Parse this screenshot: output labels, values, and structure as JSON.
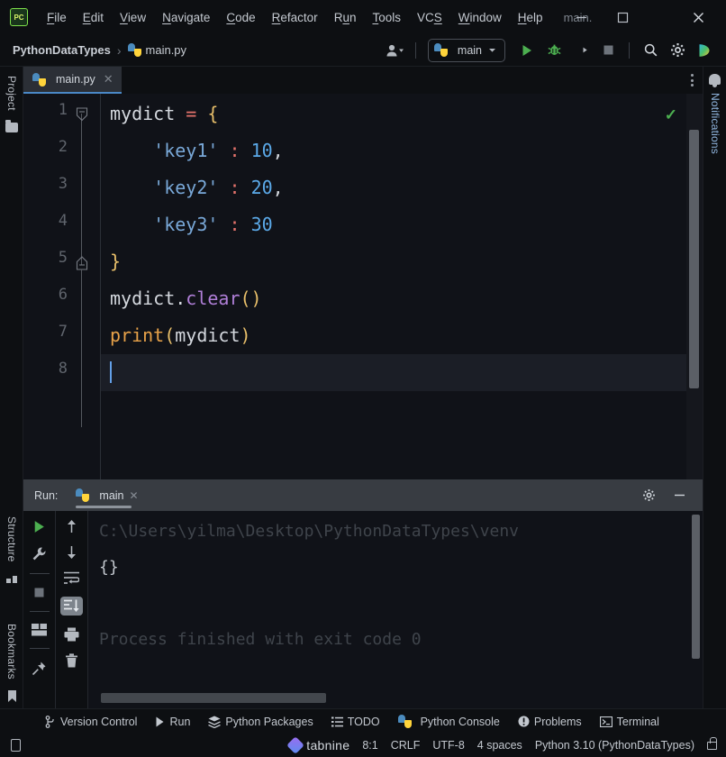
{
  "window": {
    "title": "main.",
    "app_icon": "pycharm-logo-icon",
    "minimize_label": "─",
    "maximize_label": "□",
    "close_label": "✕"
  },
  "menubar": {
    "items": [
      {
        "label": "File",
        "mnemonic": "F"
      },
      {
        "label": "Edit",
        "mnemonic": "E"
      },
      {
        "label": "View",
        "mnemonic": "V"
      },
      {
        "label": "Navigate",
        "mnemonic": "N"
      },
      {
        "label": "Code",
        "mnemonic": "C"
      },
      {
        "label": "Refactor",
        "mnemonic": "R"
      },
      {
        "label": "Run",
        "mnemonic": "u"
      },
      {
        "label": "Tools",
        "mnemonic": "T"
      },
      {
        "label": "VCS",
        "mnemonic": "S"
      },
      {
        "label": "Window",
        "mnemonic": "W"
      },
      {
        "label": "Help",
        "mnemonic": "H"
      }
    ]
  },
  "toolbar": {
    "breadcrumb": {
      "project": "PythonDataTypes",
      "separator": "›",
      "file": "main.py",
      "file_icon": "python-file-icon"
    },
    "account_icon": "user-account-icon",
    "run_config": {
      "name": "main",
      "icon": "python-config-icon",
      "dropdown_icon": "chevron-down-icon"
    },
    "actions": [
      {
        "name": "run-button",
        "icon": "run-triangle-icon"
      },
      {
        "name": "debug-button",
        "icon": "debug-bug-icon"
      },
      {
        "name": "run-with-coverage-button",
        "icon": "coverage-icon"
      },
      {
        "name": "stop-button",
        "icon": "stop-square-icon"
      },
      {
        "name": "search-everywhere-button",
        "icon": "search-icon"
      },
      {
        "name": "settings-button",
        "icon": "gear-icon"
      },
      {
        "name": "ai-assistant-button",
        "icon": "ai-play-icon"
      }
    ]
  },
  "left_rail": {
    "top_tabs": [
      {
        "label": "Project",
        "icon": "project-folder-icon"
      }
    ],
    "bottom_tabs": [
      {
        "label": "Bookmarks",
        "icon": "bookmark-icon"
      },
      {
        "label": "Structure",
        "icon": "structure-icon"
      }
    ]
  },
  "right_rail": {
    "tabs": [
      {
        "label": "Notifications",
        "icon": "bell-icon"
      }
    ]
  },
  "editor": {
    "tab": {
      "label": "main.py",
      "icon": "python-file-icon",
      "close_icon": "close-icon"
    },
    "more_menu_icon": "vertical-dots-icon",
    "inspection_status_icon": "check-ok-icon",
    "inspection_status": "✓",
    "current_line": 8,
    "line_numbers": [
      "1",
      "2",
      "3",
      "4",
      "5",
      "6",
      "7",
      "8"
    ],
    "code_lines": [
      {
        "num": "1",
        "tokens": [
          {
            "t": "mydict",
            "c": "t-def"
          },
          {
            "t": " ",
            "c": "t-def"
          },
          {
            "t": "=",
            "c": "t-op"
          },
          {
            "t": " ",
            "c": "t-def"
          },
          {
            "t": "{",
            "c": "t-brace"
          }
        ]
      },
      {
        "num": "2",
        "tokens": [
          {
            "t": "    ",
            "c": "t-def"
          },
          {
            "t": "'key1'",
            "c": "t-str"
          },
          {
            "t": " ",
            "c": "t-def"
          },
          {
            "t": ":",
            "c": "t-op"
          },
          {
            "t": " ",
            "c": "t-def"
          },
          {
            "t": "10",
            "c": "t-num"
          },
          {
            "t": ",",
            "c": "t-punc"
          }
        ]
      },
      {
        "num": "3",
        "tokens": [
          {
            "t": "    ",
            "c": "t-def"
          },
          {
            "t": "'key2'",
            "c": "t-str"
          },
          {
            "t": " ",
            "c": "t-def"
          },
          {
            "t": ":",
            "c": "t-op"
          },
          {
            "t": " ",
            "c": "t-def"
          },
          {
            "t": "20",
            "c": "t-num"
          },
          {
            "t": ",",
            "c": "t-punc"
          }
        ]
      },
      {
        "num": "4",
        "tokens": [
          {
            "t": "    ",
            "c": "t-def"
          },
          {
            "t": "'key3'",
            "c": "t-str"
          },
          {
            "t": " ",
            "c": "t-def"
          },
          {
            "t": ":",
            "c": "t-op"
          },
          {
            "t": " ",
            "c": "t-def"
          },
          {
            "t": "30",
            "c": "t-num"
          }
        ]
      },
      {
        "num": "5",
        "tokens": [
          {
            "t": "}",
            "c": "t-brace"
          }
        ]
      },
      {
        "num": "6",
        "tokens": [
          {
            "t": "mydict",
            "c": "t-def"
          },
          {
            "t": ".",
            "c": "t-punc"
          },
          {
            "t": "clear",
            "c": "t-fn"
          },
          {
            "t": "()",
            "c": "t-brace"
          }
        ]
      },
      {
        "num": "7",
        "tokens": [
          {
            "t": "print",
            "c": "t-bi"
          },
          {
            "t": "(",
            "c": "t-brace"
          },
          {
            "t": "mydict",
            "c": "t-def"
          },
          {
            "t": ")",
            "c": "t-brace"
          }
        ]
      },
      {
        "num": "8",
        "tokens": []
      }
    ]
  },
  "run_panel": {
    "label": "Run:",
    "tab": {
      "label": "main",
      "icon": "python-config-icon",
      "close_icon": "close-icon"
    },
    "header_actions": [
      {
        "name": "run-settings-button",
        "icon": "gear-icon"
      },
      {
        "name": "hide-panel-button",
        "icon": "minimize-icon"
      }
    ],
    "side_actions_col1": [
      {
        "name": "rerun-button",
        "icon": "run-triangle-icon"
      },
      {
        "name": "modify-options-button",
        "icon": "wrench-icon"
      },
      {
        "name": "stop-button",
        "icon": "stop-square-icon"
      },
      {
        "name": "layout-button",
        "icon": "layout-icon"
      },
      {
        "name": "pin-tab-button",
        "icon": "pin-icon"
      }
    ],
    "side_actions_col2": [
      {
        "name": "previous-occurrence-button",
        "icon": "arrow-up-icon"
      },
      {
        "name": "next-occurrence-button",
        "icon": "arrow-down-icon"
      },
      {
        "name": "soft-wrap-button",
        "icon": "soft-wrap-icon"
      },
      {
        "name": "scroll-to-end-button",
        "icon": "scroll-to-end-icon"
      },
      {
        "name": "print-button",
        "icon": "print-icon"
      },
      {
        "name": "clear-all-button",
        "icon": "trash-icon"
      }
    ],
    "console_lines": [
      {
        "text": "C:\\Users\\yilma\\Desktop\\PythonDataTypes\\venv",
        "kind": "dim"
      },
      {
        "text": "{}",
        "kind": "out"
      },
      {
        "text": "",
        "kind": "dim"
      },
      {
        "text": "Process finished with exit code 0",
        "kind": "dim"
      }
    ]
  },
  "bottom_bar": {
    "items": [
      {
        "label": "Version Control",
        "icon": "branch-icon"
      },
      {
        "label": "Run",
        "icon": "run-triangle-icon"
      },
      {
        "label": "Python Packages",
        "icon": "packages-icon"
      },
      {
        "label": "TODO",
        "icon": "todo-list-icon"
      },
      {
        "label": "Python Console",
        "icon": "python-console-icon"
      },
      {
        "label": "Problems",
        "icon": "problems-icon"
      },
      {
        "label": "Terminal",
        "icon": "terminal-icon"
      }
    ]
  },
  "status_bar": {
    "left_icon": "show-tool-windows-icon",
    "plugin": {
      "name": "tabnine",
      "icon": "tabnine-icon"
    },
    "caret_position": "8:1",
    "line_separator": "CRLF",
    "encoding": "UTF-8",
    "indent": "4 spaces",
    "interpreter": "Python 3.10 (PythonDataTypes)",
    "lock_icon": "lock-icon"
  },
  "colors": {
    "editor_bg": "#101218",
    "chrome_bg": "#0d0f12",
    "tab_active_bg": "#2b2f36",
    "tab_underline": "#4a88c7",
    "run_header_bg": "#383c42",
    "accent_green": "#4caf50",
    "string": "#79a8d8",
    "number": "#5ba9e8",
    "operator": "#e4726b",
    "brace": "#e8bf6a",
    "function": "#b07fd8",
    "builtin": "#e8a249",
    "caret": "#63a0e8",
    "current_line": "#1b1e26"
  }
}
